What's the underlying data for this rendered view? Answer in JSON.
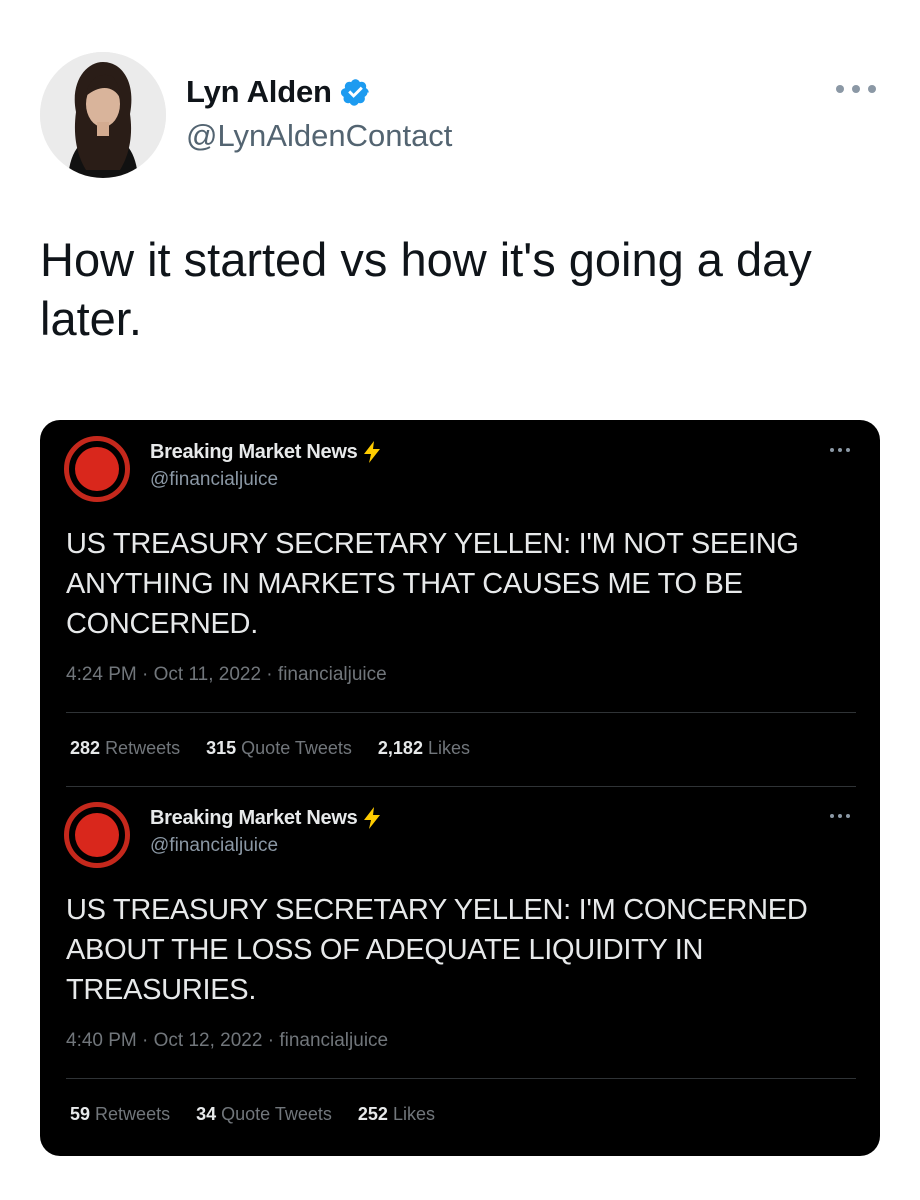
{
  "tweet": {
    "author_name": "Lyn Alden",
    "author_handle": "@LynAldenContact",
    "text": "How it started vs how it's going a day later."
  },
  "quoted_tweets": [
    {
      "name": "Breaking Market News",
      "handle": "@financialjuice",
      "body": "US TREASURY SECRETARY YELLEN: I'M NOT SEEING ANYTHING IN MARKETS THAT CAUSES ME TO BE CONCERNED.",
      "meta": "4:24 PM · Oct 11, 2022 · financialjuice",
      "retweets": "282",
      "retweets_label": "Retweets",
      "quotes": "315",
      "quotes_label": "Quote Tweets",
      "likes": "2,182",
      "likes_label": "Likes"
    },
    {
      "name": "Breaking Market News",
      "handle": "@financialjuice",
      "body": "US TREASURY SECRETARY YELLEN: I'M CONCERNED ABOUT THE LOSS OF ADEQUATE LIQUIDITY IN TREASURIES.",
      "meta": "4:40 PM · Oct 12, 2022 · financialjuice",
      "retweets": "59",
      "retweets_label": "Retweets",
      "quotes": "34",
      "quotes_label": "Quote Tweets",
      "likes": "252",
      "likes_label": "Likes"
    }
  ],
  "icons": {
    "verified": "verified-badge-icon",
    "more": "more-options-icon",
    "bolt": "lightning-bolt-icon"
  },
  "colors": {
    "verified_blue": "#1d9bf0",
    "card_background": "#000000",
    "avatar_red": "#d9271c",
    "bolt_yellow": "#ffcc00"
  }
}
